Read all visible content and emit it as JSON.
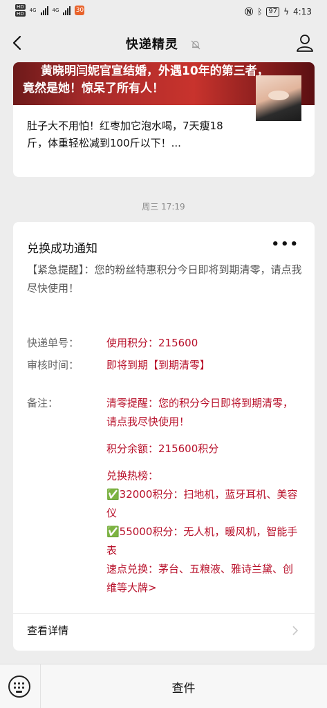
{
  "status_bar": {
    "hd1": "HD",
    "hd2": "HD",
    "net1": "4G",
    "net2": "4G",
    "app_badge": "30",
    "battery": "97",
    "time": "4:13"
  },
  "nav": {
    "title": "快递精灵"
  },
  "article": {
    "banner_line1": "黄晓明闫妮官宣结婚，外遇10年的第三者，",
    "banner_line2": "竟然是她！惊呆了所有人！",
    "title": "肚子大不用怕！红枣加它泡水喝，7天瘦18斤，体重轻松减到100斤以下！..."
  },
  "timestamp": "周三 17:19",
  "notice": {
    "title": "兑换成功通知",
    "more": "•••",
    "description": "【紧急提醒】：您的粉丝特惠积分今日即将到期清零，请点我尽快使用！",
    "rows": [
      {
        "key": "快递单号：",
        "value": "使用积分：215600"
      },
      {
        "key": "审核时间：",
        "value": "即将到期【到期清零】"
      },
      {
        "key": "备注：",
        "value": "清零提醒：您的积分今日即将到期清零，请点我尽快使用！"
      }
    ],
    "remarks": {
      "balance": "积分余额：215600积分",
      "hot_title": "兑换热榜：",
      "hot1": "✅32000积分：扫地机，蓝牙耳机、美容仪",
      "hot2": "✅55000积分：无人机，暖风机，智能手表",
      "quick": "速点兑换：茅台、五粮液、雅诗兰黛、创维等大牌>"
    },
    "footer": "查看详情"
  },
  "bottom_bar": {
    "menu": "查件"
  },
  "colors": {
    "accent_red": "#b8102a",
    "background": "#ededed",
    "card": "#ffffff"
  }
}
